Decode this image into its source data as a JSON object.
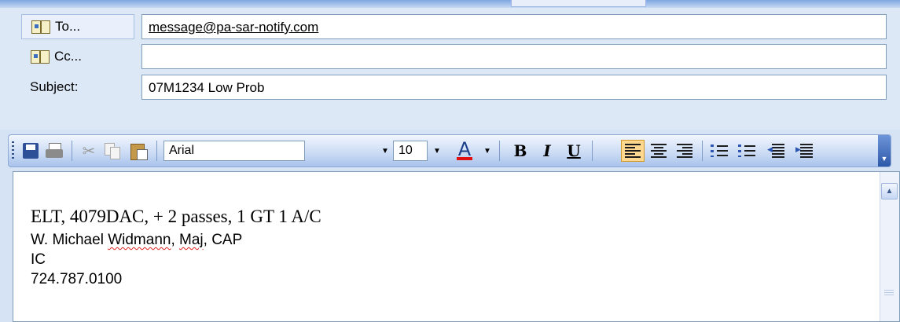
{
  "header": {
    "to_label": "To...",
    "to_value": "message@pa-sar-notify.com",
    "cc_label": "Cc...",
    "cc_value": "",
    "subject_label": "Subject:",
    "subject_value": "07M1234 Low Prob"
  },
  "toolbar": {
    "font_name": "Arial",
    "font_size": "10",
    "icons": [
      "save-icon",
      "print-icon",
      "cut-icon",
      "copy-icon",
      "paste-icon",
      "font-color-icon",
      "bold-icon",
      "italic-icon",
      "underline-icon",
      "align-left-icon",
      "align-center-icon",
      "align-right-icon",
      "numbered-list-icon",
      "bullet-list-icon",
      "decrease-indent-icon",
      "increase-indent-icon",
      "toolbar-options-icon"
    ],
    "bold_glyph": "B",
    "italic_glyph": "I",
    "underline_glyph": "U",
    "font_color_glyph": "A",
    "active_alignment": "left",
    "font_color": "#e01010"
  },
  "message": {
    "line1": "ELT, 4079DAC, + 2 passes, 1 GT 1 A/C",
    "line2_prefix": "W. Michael ",
    "line2_name": "Widmann",
    "line2_mid": ", ",
    "line2_rank": "Maj",
    "line2_suffix": ", CAP",
    "line3": "IC",
    "line4": "724.787.0100"
  },
  "colors": {
    "header_bg": "#dde8f7",
    "toolbar_highlight": "#ffd890",
    "link_text": "#000000"
  }
}
